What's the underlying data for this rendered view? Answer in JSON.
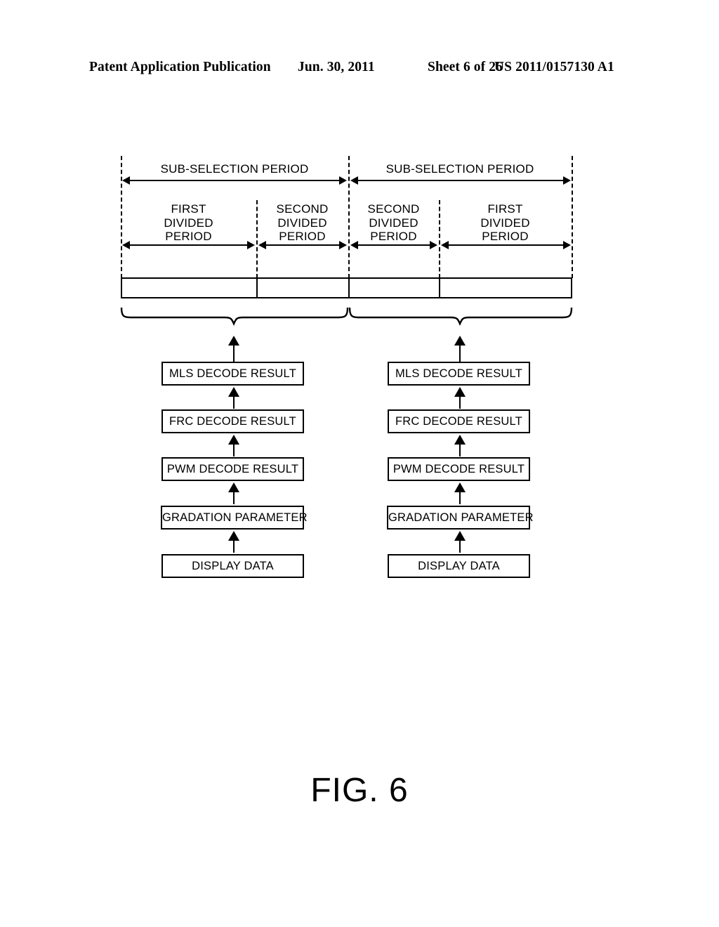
{
  "header": {
    "publication": "Patent Application Publication",
    "date": "Jun. 30, 2011",
    "sheet": "Sheet 6 of 26",
    "number": "US 2011/0157130 A1"
  },
  "figure": {
    "caption": "FIG. 6",
    "timing": {
      "sub_selection_periods": [
        {
          "label": "SUB-SELECTION PERIOD"
        },
        {
          "label": "SUB-SELECTION PERIOD"
        }
      ],
      "divided_periods": [
        {
          "line1": "FIRST",
          "line2": "DIVIDED",
          "line3": "PERIOD"
        },
        {
          "line1": "SECOND",
          "line2": "DIVIDED",
          "line3": "PERIOD"
        },
        {
          "line1": "SECOND",
          "line2": "DIVIDED",
          "line3": "PERIOD"
        },
        {
          "line1": "FIRST",
          "line2": "DIVIDED",
          "line3": "PERIOD"
        }
      ]
    },
    "stacks": [
      {
        "name": "left-stack",
        "boxes": [
          {
            "label": "MLS DECODE RESULT"
          },
          {
            "label": "FRC DECODE RESULT"
          },
          {
            "label": "PWM DECODE RESULT"
          },
          {
            "label": "GRADATION PARAMETER"
          },
          {
            "label": "DISPLAY DATA"
          }
        ]
      },
      {
        "name": "right-stack",
        "boxes": [
          {
            "label": "MLS DECODE RESULT"
          },
          {
            "label": "FRC DECODE RESULT"
          },
          {
            "label": "PWM DECODE RESULT"
          },
          {
            "label": "GRADATION PARAMETER"
          },
          {
            "label": "DISPLAY DATA"
          }
        ]
      }
    ]
  },
  "colors": {
    "ink": "#000000",
    "paper": "#ffffff"
  }
}
